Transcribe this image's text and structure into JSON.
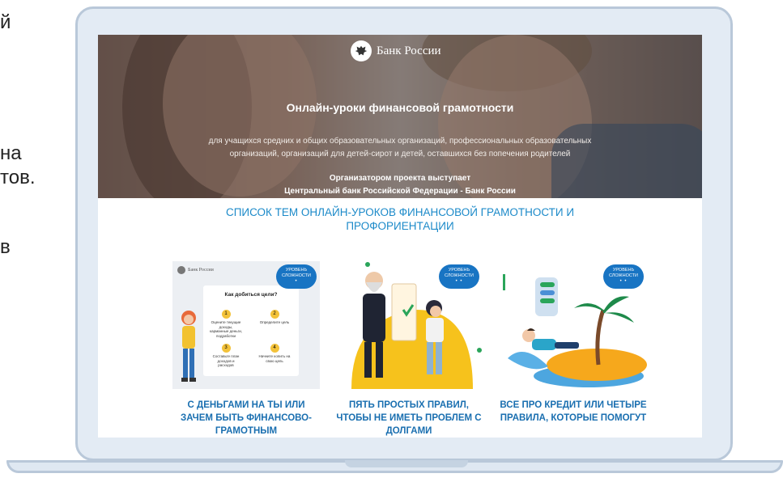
{
  "slide_fragments": [
    "й",
    "на",
    "тов.",
    "в"
  ],
  "hero": {
    "logo_text": "Банк России",
    "title": "Онлайн-уроки финансовой грамотности",
    "description": "для учащихся средних и общих образовательных организаций, профессиональных образовательных организаций, организаций для детей-сирот и детей, оставшихся без попечения родителей",
    "organizer_line1": "Организатором проекта выступает",
    "organizer_line2": "Центральный банк Российской Федерации - Банк России"
  },
  "list_heading": "СПИСОК ТЕМ ОНЛАЙН-УРОКОВ ФИНАНСОВОЙ ГРАМОТНОСТИ И ПРОФОРИЕНТАЦИИ",
  "cards": [
    {
      "title": "С ДЕНЬГАМИ НА ТЫ ИЛИ ЗАЧЕМ БЫТЬ ФИНАНСОВО-ГРАМОТНЫМ",
      "level_label": "УРОВЕНЬ СЛОЖНОСТИ",
      "level_dots": "•",
      "image": {
        "logo_text": "Банк России",
        "question": "Как добиться цели?",
        "steps": [
          "Оцените текущие доходы, карманные деньги, подработки",
          "Определите цель",
          "Составьте план доходов и расходов",
          "Начните копить на свою цель"
        ],
        "step_numbers": [
          "1",
          "2",
          "3",
          "4"
        ]
      }
    },
    {
      "title": "ПЯТЬ ПРОСТЫХ ПРАВИЛ, ЧТОБЫ НЕ ИМЕТЬ ПРОБЛЕМ С ДОЛГАМИ",
      "level_label": "УРОВЕНЬ СЛОЖНОСТИ",
      "level_dots": "• •"
    },
    {
      "title": "ВСЕ ПРО КРЕДИТ ИЛИ ЧЕТЫРЕ ПРАВИЛА, КОТОРЫЕ ПОМОГУТ",
      "level_label": "УРОВЕНЬ СЛОЖНОСТИ",
      "level_dots": "• •"
    }
  ],
  "colors": {
    "heading_blue": "#1c8ac9",
    "card_title_blue": "#1a6fb0",
    "badge_blue": "#1874c3",
    "laptop_frame": "#b9c8d9"
  }
}
